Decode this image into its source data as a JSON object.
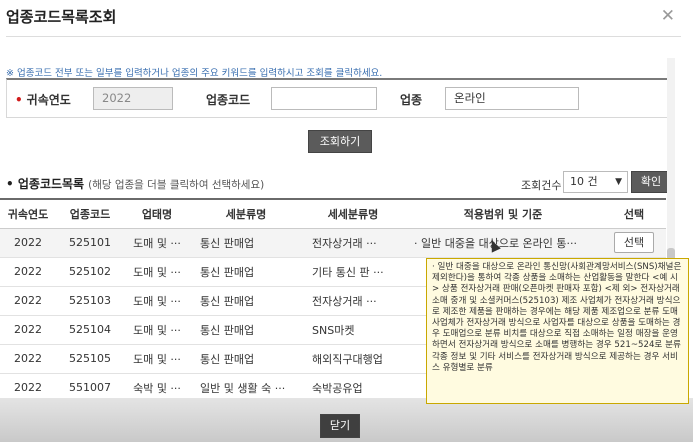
{
  "dialog": {
    "title": "업종코드목록조회",
    "close_glyph": "✕"
  },
  "notice": "※ 업종코드 전부 또는 일부를 입력하거나 업종의 주요 키워드를 입력하시고 조회를 클릭하세요.",
  "search": {
    "year_label": "귀속연도",
    "year_value": "2022",
    "code_label": "업종코드",
    "code_value": "",
    "industry_label": "업종",
    "industry_value": "온라인",
    "submit_label": "조회하기"
  },
  "list": {
    "title": "업종코드목록",
    "hint": "(해당 업종을 더블 클릭하여 선택하세요)",
    "count_label": "조회건수",
    "count_value": "10 건",
    "confirm_label": "확인"
  },
  "table": {
    "headers": [
      "귀속연도",
      "업종코드",
      "업태명",
      "세분류명",
      "세세분류명",
      "적용범위 및 기준",
      "선택"
    ],
    "rows": [
      [
        "2022",
        "525101",
        "도매 및 ···",
        "통신 판매업",
        "전자상거래 ···",
        "· 일반 대중을 대상으로 온라인 통···",
        "선택"
      ],
      [
        "2022",
        "525102",
        "도매 및 ···",
        "통신 판매업",
        "기타 통신 판 ···",
        "",
        ""
      ],
      [
        "2022",
        "525103",
        "도매 및 ···",
        "통신 판매업",
        "전자상거래 ···",
        "",
        ""
      ],
      [
        "2022",
        "525104",
        "도매 및 ···",
        "통신 판매업",
        "SNS마켓",
        "",
        ""
      ],
      [
        "2022",
        "525105",
        "도매 및 ···",
        "통신 판매업",
        "해외직구대행업",
        "",
        ""
      ],
      [
        "2022",
        "551007",
        "숙박 및 ···",
        "일반 및 생활 숙 ···",
        "숙박공유업",
        "",
        ""
      ]
    ]
  },
  "tooltip": "· 일반 대중을 대상으로 온라인 통신망(사회관계망서비스(SNS)채널은 제외한다)을 통하여 각종 상품을 소매하는 산업활동을 말한다 <예 시> 상품 전자상거래 판매(오픈마켓 판매자 포함) <제 외> 전자상거래 소매 중개 및 소셜커머스(525103) 제조 사업체가 전자상거래 방식으로 제조한 제품을 판매하는 경우에는 해당 제품 제조업으로 분류 도매 사업체가 전자상거래 방식으로 사업자를 대상으로 상품을 도매하는 경우 도매업으로 분류 비치를 대상으로 직접 소매하는 일정 매장을 운영하면서 전자상거래 방식으로 소매를 병행하는 경우 521~524로 분류 각종 정보 및 기타 서비스를 전자상거래 방식으로 제공하는 경우 서비스 유형별로 분류",
  "footer": {
    "close_label": "닫기"
  }
}
